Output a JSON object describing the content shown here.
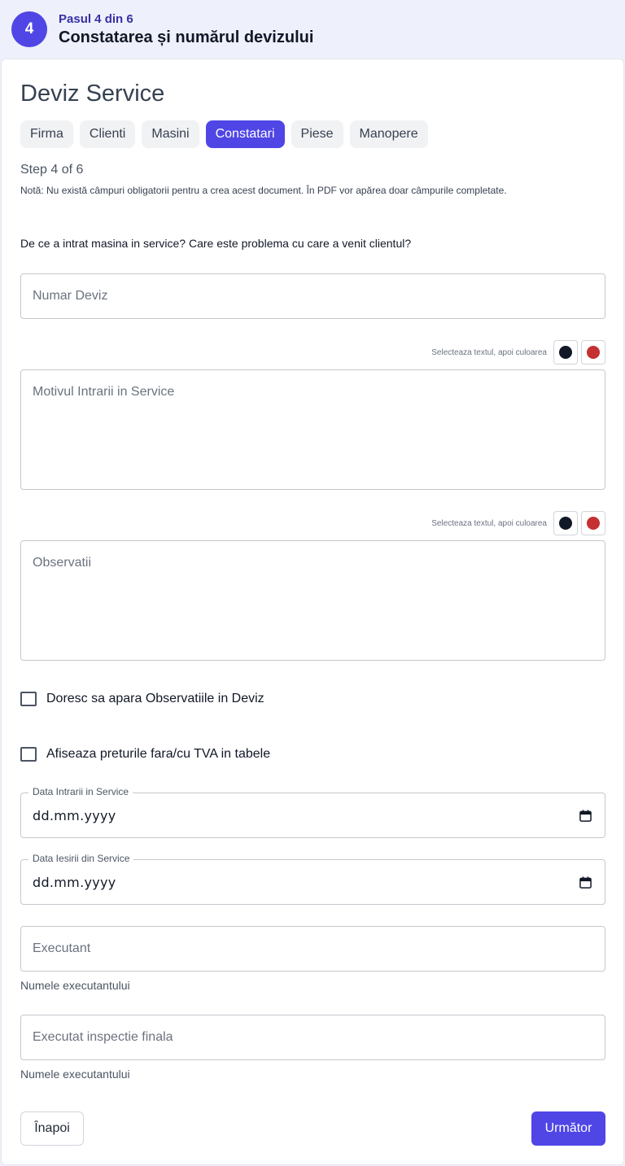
{
  "banner": {
    "step_number": "4",
    "kicker": "Pasul 4 din 6",
    "title": "Constatarea și numărul devizului"
  },
  "document": {
    "title": "Deviz Service",
    "tabs": [
      {
        "label": "Firma",
        "active": false
      },
      {
        "label": "Clienti",
        "active": false
      },
      {
        "label": "Masini",
        "active": false
      },
      {
        "label": "Constatari",
        "active": true
      },
      {
        "label": "Piese",
        "active": false
      },
      {
        "label": "Manopere",
        "active": false
      }
    ],
    "step_of": "Step 4 of 6",
    "note": "Notă: Nu există câmpuri obligatorii pentru a crea acest document. În PDF vor apărea doar câmpurile completate."
  },
  "form": {
    "question": "De ce a intrat masina in service? Care este problema cu care a venit clientul?",
    "numar_deviz": {
      "placeholder": "Numar Deviz",
      "value": ""
    },
    "color_hint": "Selecteaza textul, apoi culoarea",
    "colors": {
      "dark": "#111827",
      "red": "#c53030"
    },
    "motiv": {
      "placeholder": "Motivul Intrarii in Service",
      "value": ""
    },
    "observatii": {
      "placeholder": "Observatii",
      "value": ""
    },
    "checkbox_observatii": {
      "label": "Doresc sa apara Observatiile in Deviz",
      "checked": false
    },
    "checkbox_tva": {
      "label": "Afiseaza preturile fara/cu TVA in tabele",
      "checked": false
    },
    "data_intrare": {
      "label": "Data Intrarii in Service",
      "value": "dd.mm.yyyy"
    },
    "data_iesire": {
      "label": "Data Iesirii din Service",
      "value": "dd.mm.yyyy"
    },
    "executant": {
      "placeholder": "Executant",
      "helper": "Numele executantului"
    },
    "inspectie": {
      "placeholder": "Executat inspectie finala",
      "helper": "Numele executantului"
    }
  },
  "actions": {
    "back_label": "Înapoi",
    "next_label": "Următor"
  },
  "theme": {
    "accent": "#4f46e5"
  }
}
